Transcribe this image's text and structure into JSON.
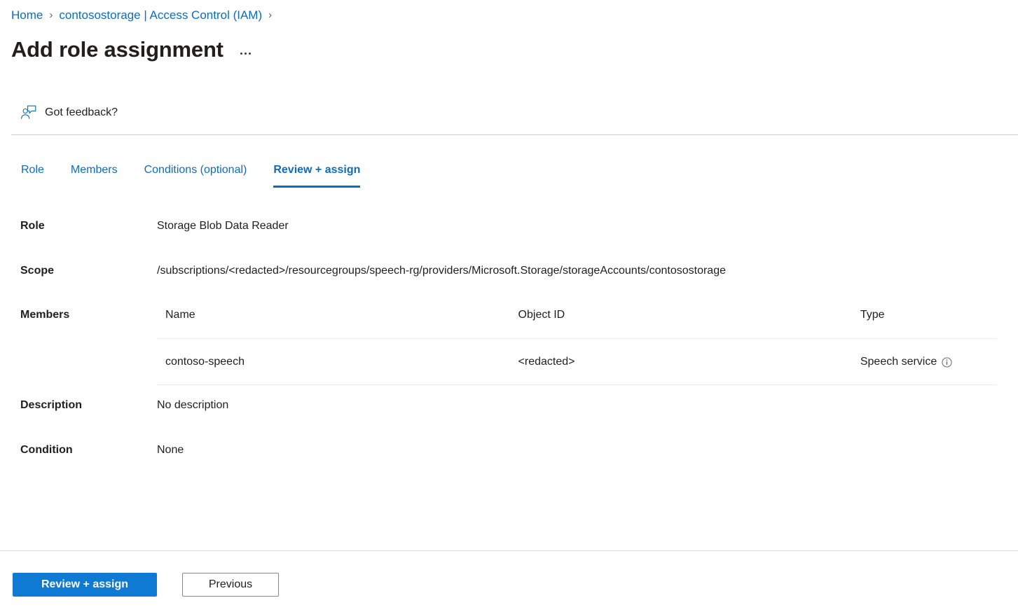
{
  "breadcrumb": {
    "items": [
      {
        "label": "Home"
      },
      {
        "label": "contosostorage | Access Control (IAM)"
      }
    ],
    "separator": "›"
  },
  "header": {
    "title": "Add role assignment",
    "more_menu_label": "…"
  },
  "feedback": {
    "label": "Got feedback?",
    "icon": "feedback-person-icon"
  },
  "tabs": [
    {
      "label": "Role",
      "active": false
    },
    {
      "label": "Members",
      "active": false
    },
    {
      "label": "Conditions (optional)",
      "active": false
    },
    {
      "label": "Review + assign",
      "active": true
    }
  ],
  "details": {
    "role": {
      "label": "Role",
      "value": "Storage Blob Data Reader"
    },
    "scope": {
      "label": "Scope",
      "value": "/subscriptions/<redacted>/resourcegroups/speech-rg/providers/Microsoft.Storage/storageAccounts/contosostorage"
    },
    "members": {
      "label": "Members",
      "columns": [
        "Name",
        "Object ID",
        "Type"
      ],
      "rows": [
        {
          "name": "contoso-speech",
          "object_id": "<redacted>",
          "type": "Speech service",
          "type_info_icon": "info-icon"
        }
      ]
    },
    "description": {
      "label": "Description",
      "value": "No description"
    },
    "condition": {
      "label": "Condition",
      "value": "None"
    }
  },
  "footer": {
    "submit_label": "Review + assign",
    "previous_label": "Previous"
  },
  "colors": {
    "link": "#0f6cbd",
    "primary_button": "#0f7ad4",
    "text": "#201f1e",
    "divider": "#d2d0ce",
    "table_rule": "#edebe9"
  }
}
